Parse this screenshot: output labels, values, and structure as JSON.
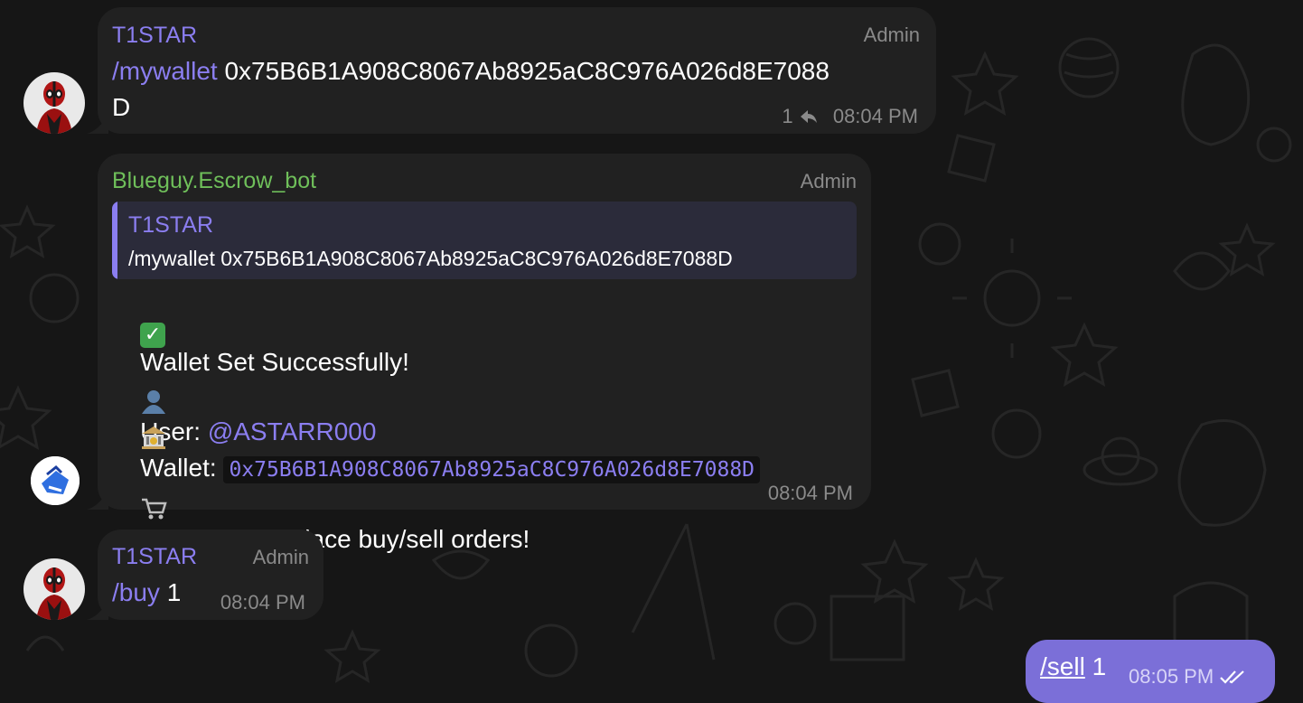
{
  "messages": [
    {
      "sender": "T1STAR",
      "role": "Admin",
      "command": "/mywallet",
      "text_line1": " 0x75B6B1A908C8067Ab8925aC8C976A026d8E7088",
      "text_line2": "D",
      "reply_count": "1",
      "time": "08:04 PM"
    },
    {
      "sender": "Blueguy.Escrow_bot",
      "role": "Admin",
      "quote_sender": "T1STAR",
      "quote_text": "/mywallet 0x75B6B1A908C8067Ab8925aC8C976A026d8E7088D",
      "line_success": "Wallet Set Successfully!",
      "user_label": "User: ",
      "user_mention": "@ASTARR000",
      "wallet_label": "Wallet: ",
      "wallet_value": "0x75B6B1A908C8067Ab8925aC8C976A026d8E7088D",
      "line_orders": "You can now place buy/sell orders!",
      "time": "08:04 PM"
    },
    {
      "sender": "T1STAR",
      "role": "Admin",
      "command": "/buy",
      "text": " 1",
      "time": "08:04 PM"
    },
    {
      "command": "/sell",
      "text": " 1",
      "time": "08:05 PM"
    }
  ],
  "icons": {
    "success": "check-mark-button-icon",
    "user": "bust-icon",
    "wallet": "bank-icon",
    "cart": "shopping-cart-icon",
    "read_status": "double-check-icon",
    "reply": "reply-arrow-icon"
  },
  "colors": {
    "background": "#161616",
    "bubble": "#212121",
    "own_bubble": "#7b6fd8",
    "accent": "#8b7ef0",
    "bot_name": "#6fbf5a",
    "meta": "#8a8a8a"
  }
}
